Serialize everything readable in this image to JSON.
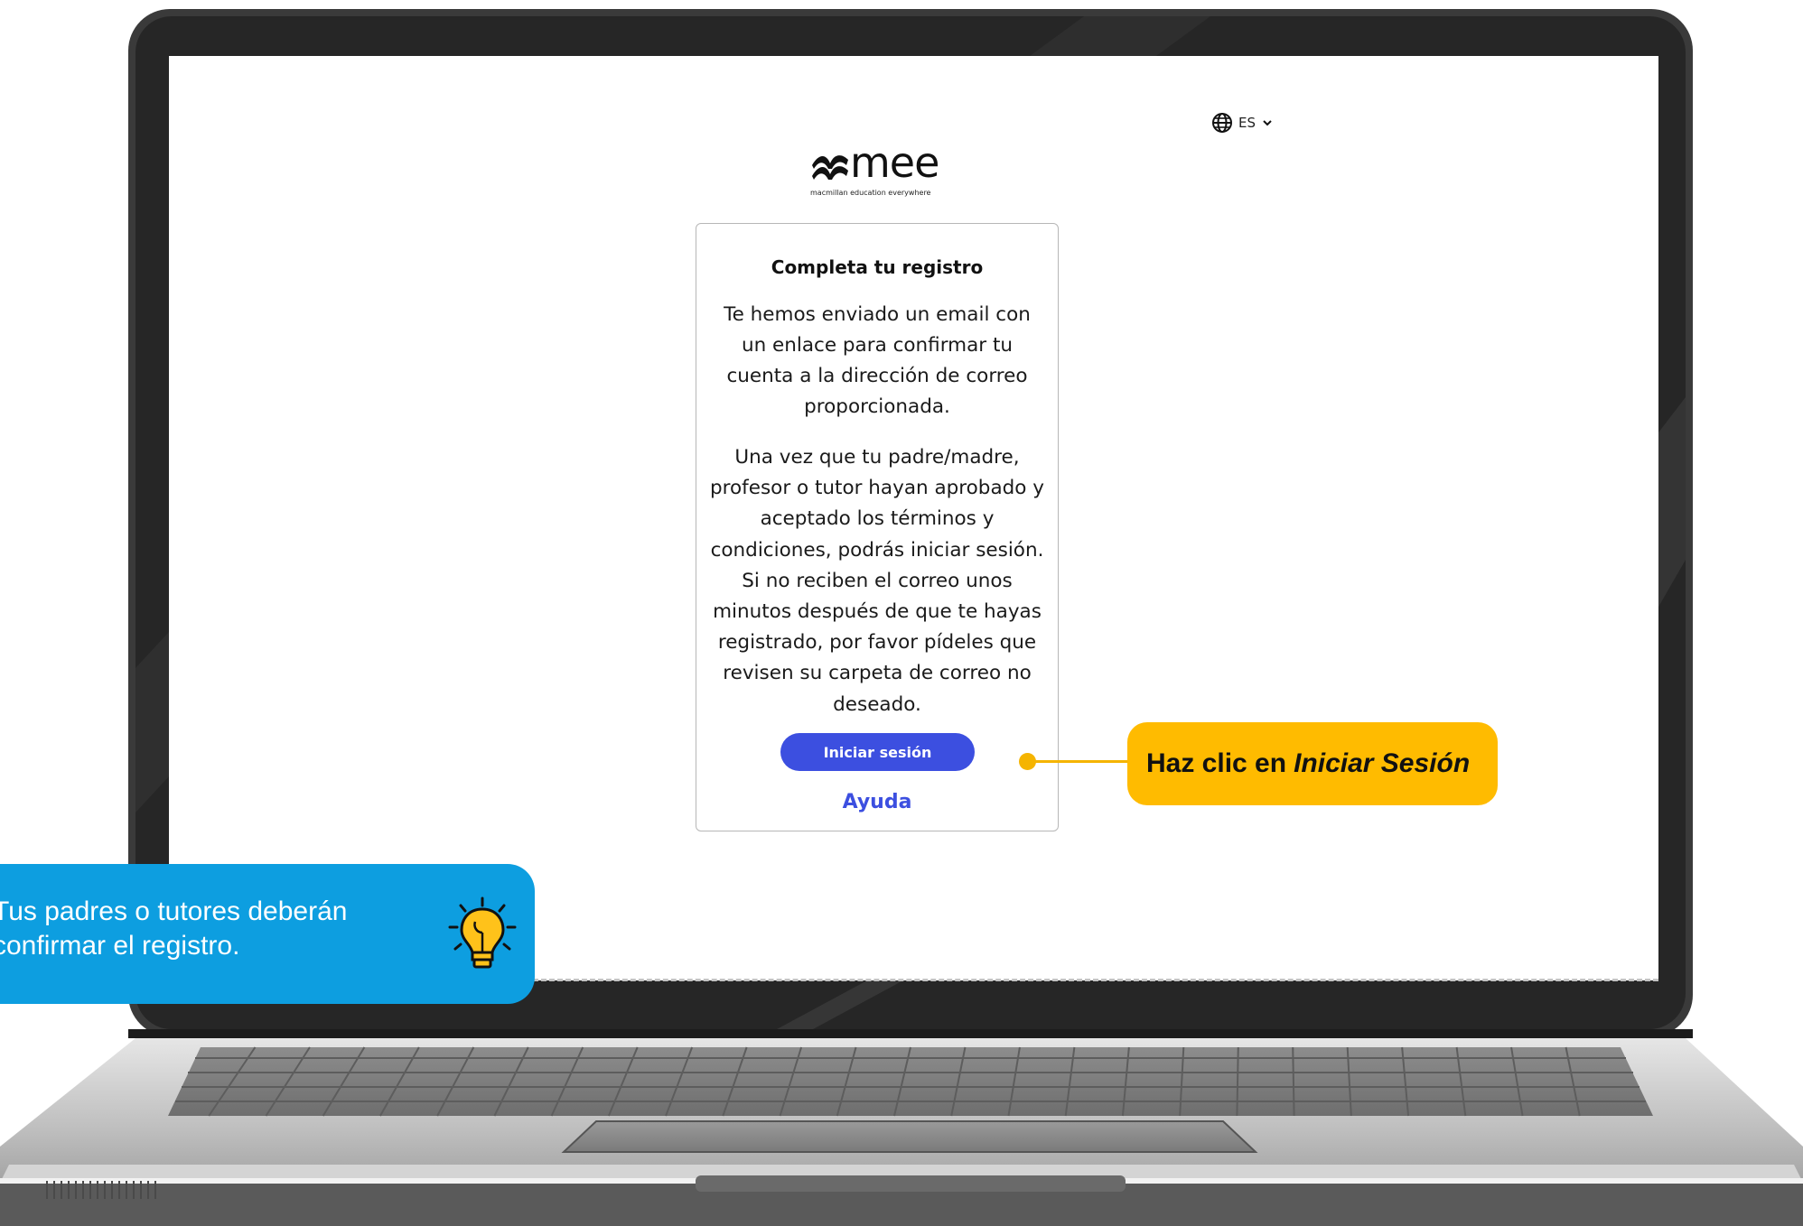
{
  "language_selector": {
    "label": "ES",
    "icon": "globe-icon"
  },
  "logo": {
    "wordmark": "mee",
    "tagline": "macmillan education everywhere"
  },
  "card": {
    "title": "Completa tu registro",
    "paragraph_1": "Te hemos enviado un email con un enlace para confirmar tu cuenta a la dirección de correo proporcionada.",
    "paragraph_2": "Una vez que tu padre/madre, profesor o tutor hayan aprobado y aceptado los términos y condiciones, podrás iniciar sesión. Si no reciben el correo unos minutos después de que te hayas registrado, por favor pídeles que revisen su carpeta de correo no deseado.",
    "login_button": "Iniciar sesión",
    "help_link": "Ayuda"
  },
  "callout": {
    "prefix": "Haz clic en",
    "emphasis": "Iniciar Sesión"
  },
  "tip": {
    "text": "Tus padres o tutores deberán confirmar el registro.",
    "icon": "lightbulb-icon"
  },
  "colors": {
    "primary_blue": "#3c4fe0",
    "callout_yellow": "#ffbb00",
    "tip_blue": "#0d9ee0",
    "laptop_frame": "#2b2b2b"
  }
}
